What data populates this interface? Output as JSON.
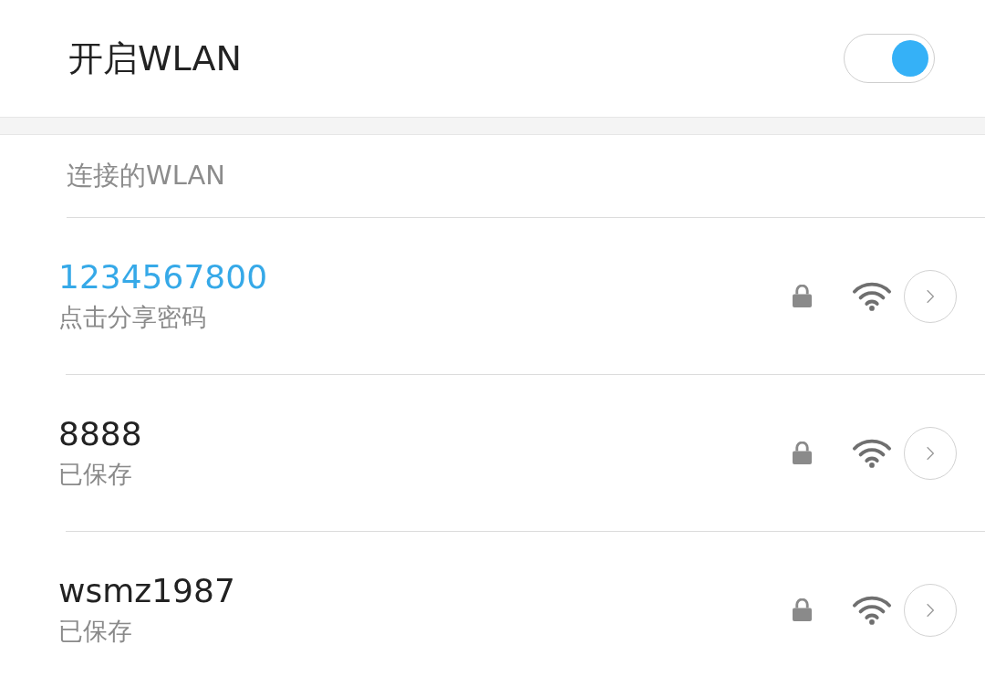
{
  "wlan_switch": {
    "label": "开启WLAN",
    "on": true
  },
  "section": {
    "title": "连接的WLAN"
  },
  "networks": [
    {
      "name": "1234567800",
      "status": "点击分享密码",
      "connected": true,
      "secured": true
    },
    {
      "name": "8888",
      "status": "已保存",
      "connected": false,
      "secured": true
    },
    {
      "name": "wsmz1987",
      "status": "已保存",
      "connected": false,
      "secured": true
    }
  ]
}
